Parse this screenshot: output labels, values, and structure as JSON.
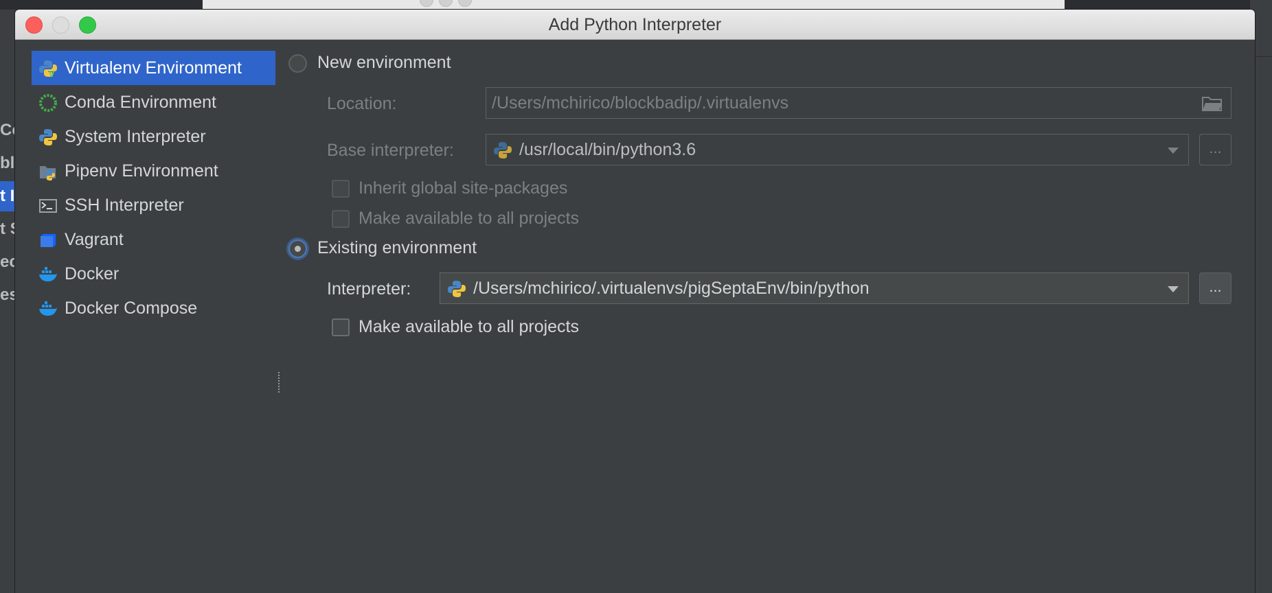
{
  "dialog": {
    "title": "Add Python Interpreter"
  },
  "sidebar": {
    "items": [
      {
        "label": "Virtualenv Environment",
        "icon": "virtualenv-icon",
        "selected": true
      },
      {
        "label": "Conda Environment",
        "icon": "conda-icon",
        "selected": false
      },
      {
        "label": "System Interpreter",
        "icon": "python-icon",
        "selected": false
      },
      {
        "label": "Pipenv Environment",
        "icon": "pipenv-icon",
        "selected": false
      },
      {
        "label": "SSH Interpreter",
        "icon": "terminal-icon",
        "selected": false
      },
      {
        "label": "Vagrant",
        "icon": "vagrant-icon",
        "selected": false
      },
      {
        "label": "Docker",
        "icon": "docker-icon",
        "selected": false
      },
      {
        "label": "Docker Compose",
        "icon": "docker-compose-icon",
        "selected": false
      }
    ]
  },
  "new_env": {
    "radio_label": "New environment",
    "selected": false,
    "location_label": "Location:",
    "location_value": "/Users/mchirico/blockbadip/.virtualenvs",
    "base_interpreter_label": "Base interpreter:",
    "base_interpreter_value": "/usr/local/bin/python3.6",
    "inherit_label": "Inherit global site-packages",
    "make_available_label": "Make available to all projects"
  },
  "existing_env": {
    "radio_label": "Existing environment",
    "selected": true,
    "interpreter_label": "Interpreter:",
    "interpreter_value": "/Users/mchirico/.virtualenvs/pigSeptaEnv/bin/python",
    "make_available_label": "Make available to all projects"
  },
  "browse_label": "...",
  "background": {
    "left_fragments": [
      "Co",
      "bl",
      "t I",
      "t S",
      "ec",
      "es"
    ]
  },
  "colors": {
    "selection": "#2f65ca",
    "dialog_bg": "#3c3f41",
    "text": "#d4d6d8",
    "disabled_text": "#7d8083"
  }
}
